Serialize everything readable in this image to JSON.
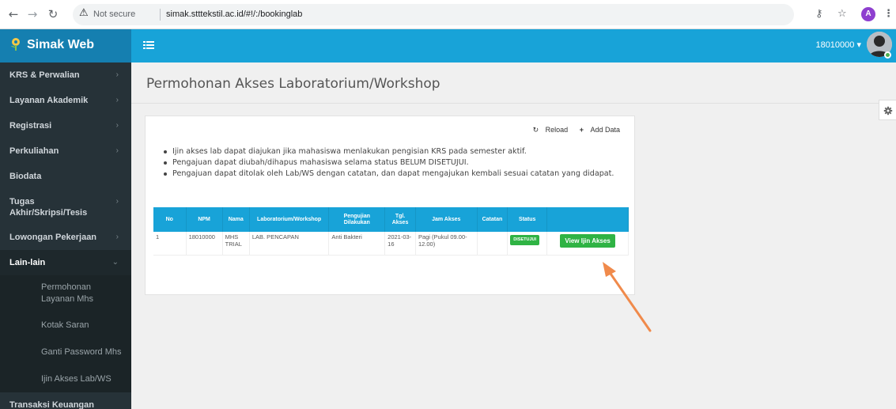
{
  "browser": {
    "security_label": "Not secure",
    "url": "simak.stttekstil.ac.id/#!/:/bookinglab",
    "profile_initial": "A"
  },
  "header": {
    "brand": "Simak Web",
    "user": "18010000",
    "colors": {
      "header": "#18a3d8",
      "brand": "#157fb0",
      "sidebar": "#263238",
      "success": "#2fb344"
    }
  },
  "sidebar": {
    "items": [
      {
        "label": "KRS & Perwalian",
        "chevron": "›"
      },
      {
        "label": "Layanan Akademik",
        "chevron": "›"
      },
      {
        "label": "Registrasi",
        "chevron": "›"
      },
      {
        "label": "Perkuliahan",
        "chevron": "›"
      },
      {
        "label": "Biodata",
        "chevron": ""
      },
      {
        "label": "Tugas",
        "label2": "Akhir/Skripsi/Tesis",
        "chevron": "›"
      },
      {
        "label": "Lowongan Pekerjaan",
        "chevron": "›"
      },
      {
        "label": "Lain-lain",
        "chevron": "⌄"
      }
    ],
    "sub_items": [
      {
        "label": "Permohonan",
        "label2": "Layanan Mhs"
      },
      {
        "label": "Kotak Saran"
      },
      {
        "label": "Ganti Password Mhs"
      },
      {
        "label": "Ijin Akses Lab/WS"
      }
    ],
    "last_item": "Transaksi Keuangan"
  },
  "main": {
    "title": "Permohonan Akses Laboratorium/Workshop",
    "reload_label": "Reload",
    "add_label": "Add Data",
    "notes": [
      "Ijin akses lab dapat diajukan jika mahasiswa menlakukan pengisian KRS pada semester aktif.",
      "Pengajuan dapat diubah/dihapus mahasiswa selama status BELUM DISETUJUI.",
      "Pengajuan dapat ditolak oleh Lab/WS dengan catatan, dan dapat mengajukan kembali sesuai catatan yang didapat."
    ],
    "table": {
      "headers": [
        "No",
        "NPM",
        "Nama",
        "Laboratorium/Workshop",
        "Pengujian Dilakukan",
        "Tgl. Akses",
        "Jam Akses",
        "Catatan",
        "Status",
        ""
      ],
      "rows": [
        {
          "no": "1",
          "npm": "18010000",
          "nama": "MHS TRIAL",
          "lab": "LAB. PENCAPAN",
          "pengujian": "Anti Bakteri",
          "tgl": "2021-03-16",
          "jam": "Pagi (Pukul 09.00-12.00)",
          "catatan": "",
          "status": "DISETUJUI",
          "action": "View Ijin Akses"
        }
      ]
    }
  }
}
